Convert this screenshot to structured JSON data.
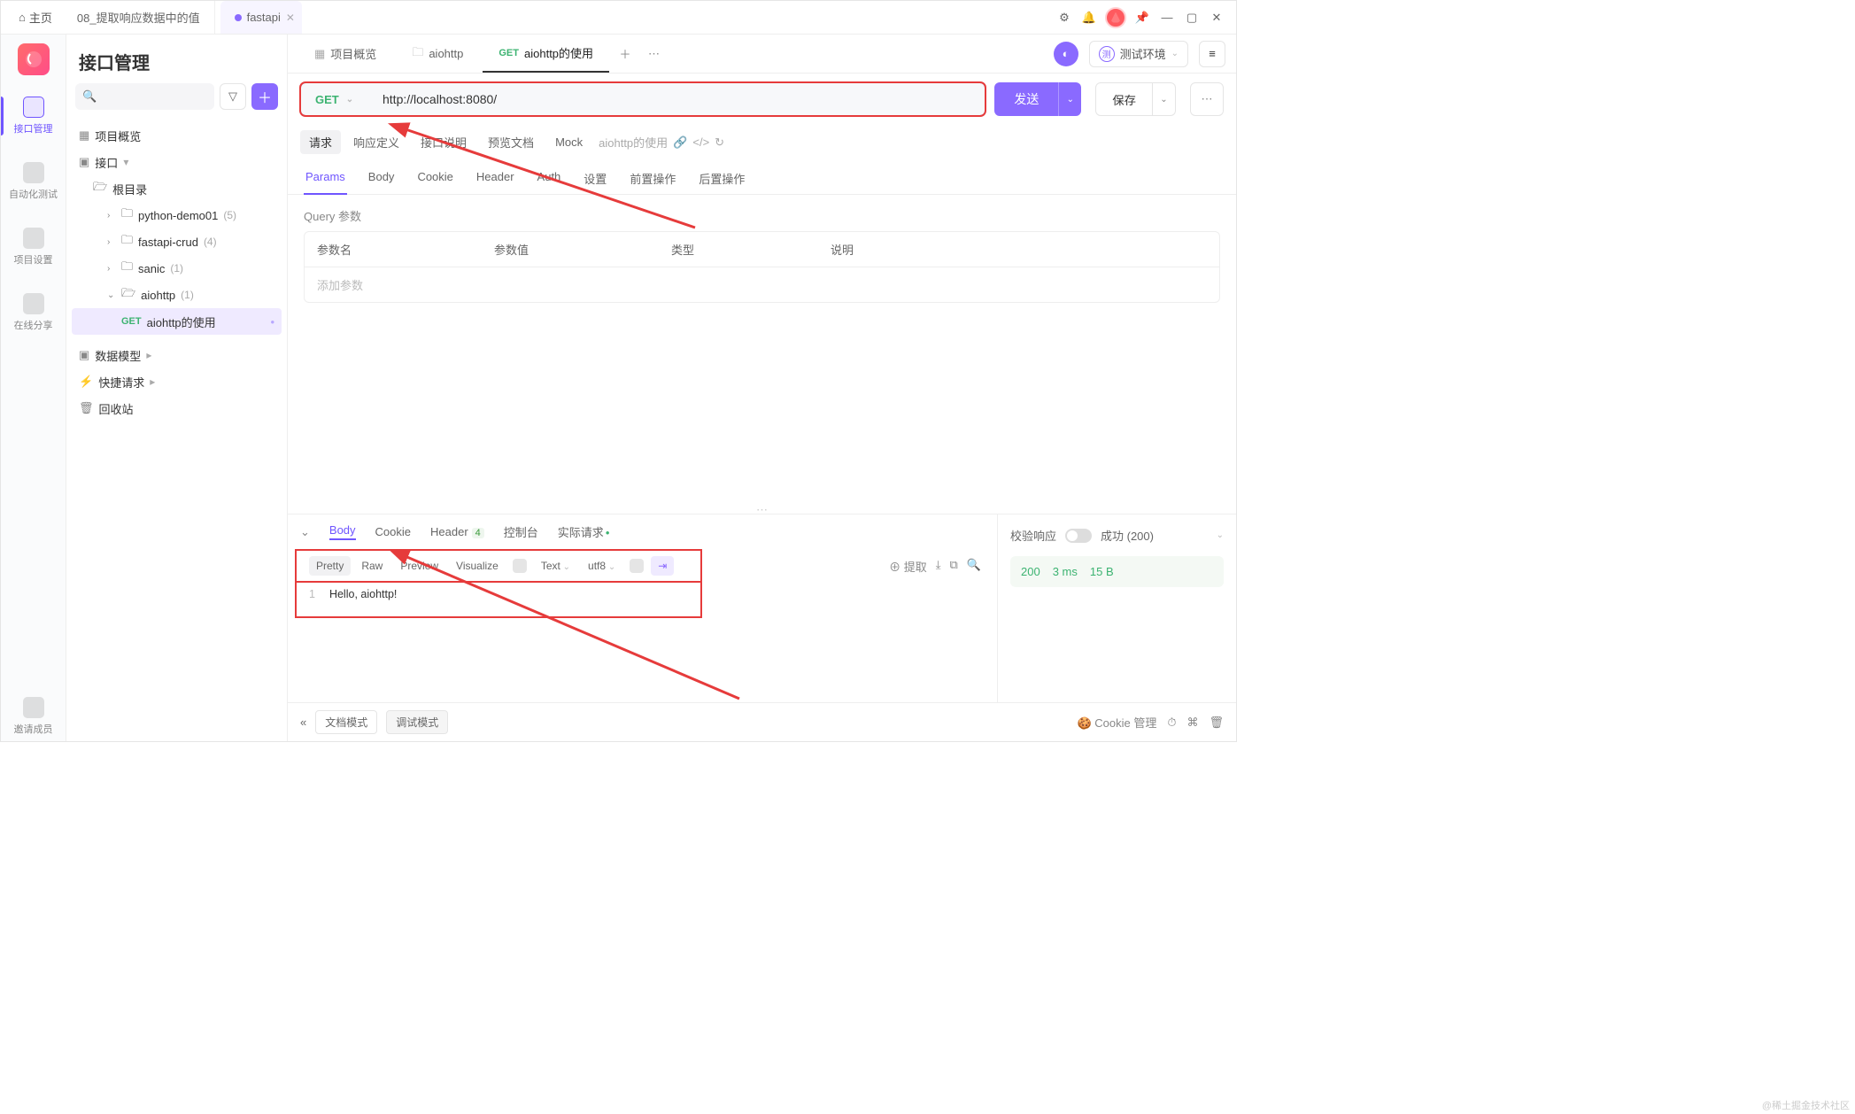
{
  "titlebar": {
    "home": "主页",
    "tab1": "08_提取响应数据中的值",
    "tab2": "fastapi"
  },
  "rail": {
    "i1": "接口管理",
    "i2": "自动化测试",
    "i3": "项目设置",
    "i4": "在线分享",
    "i5": "邀请成员"
  },
  "sidebar": {
    "title": "接口管理",
    "search_placeholder": " ",
    "nodes": {
      "overview": "项目概览",
      "api_root": "接口",
      "root_dir": "根目录",
      "f1_name": "python-demo01",
      "f1_count": "(5)",
      "f2_name": "fastapi-crud",
      "f2_count": "(4)",
      "f3_name": "sanic",
      "f3_count": "(1)",
      "f4_name": "aiohttp",
      "f4_count": "(1)",
      "leaf_method": "GET",
      "leaf_name": "aiohttp的使用",
      "models": "数据模型",
      "quick": "快捷请求",
      "recycle": "回收站"
    }
  },
  "main_tabs": {
    "overview": "项目概览",
    "folder": "aiohttp",
    "active_method": "GET",
    "active_name": "aiohttp的使用",
    "env_badge": "测",
    "env_name": "测试环境"
  },
  "request": {
    "method": "GET",
    "url": "http://localhost:8080/",
    "send": "发送",
    "save": "保存"
  },
  "sub_tabs": {
    "t1": "请求",
    "t2": "响应定义",
    "t3": "接口说明",
    "t4": "预览文档",
    "t5": "Mock",
    "meta": "aiohttp的使用"
  },
  "param_tabs": {
    "p1": "Params",
    "p2": "Body",
    "p3": "Cookie",
    "p4": "Header",
    "p5": "Auth",
    "p6": "设置",
    "p7": "前置操作",
    "p8": "后置操作"
  },
  "params": {
    "heading": "Query 参数",
    "col_name": "参数名",
    "col_value": "参数值",
    "col_type": "类型",
    "col_desc": "说明",
    "placeholder": "添加参数"
  },
  "response": {
    "tabs": {
      "body": "Body",
      "cookie": "Cookie",
      "header": "Header",
      "header_count": "4",
      "console": "控制台",
      "actual": "实际请求"
    },
    "tools": {
      "pretty": "Pretty",
      "raw": "Raw",
      "preview": "Preview",
      "visualize": "Visualize",
      "fmt": "Text",
      "enc": "utf8",
      "extract": "提取"
    },
    "body_line_no": "1",
    "body_text": "Hello, aiohttp!",
    "side": {
      "label": "校验响应",
      "ok": "成功 (200)",
      "status": "200",
      "time": "3 ms",
      "size": "15 B"
    }
  },
  "footer": {
    "mode1": "文档模式",
    "mode2": "调试模式",
    "cookie": "Cookie 管理"
  },
  "watermark": "@稀土掘金技术社区"
}
